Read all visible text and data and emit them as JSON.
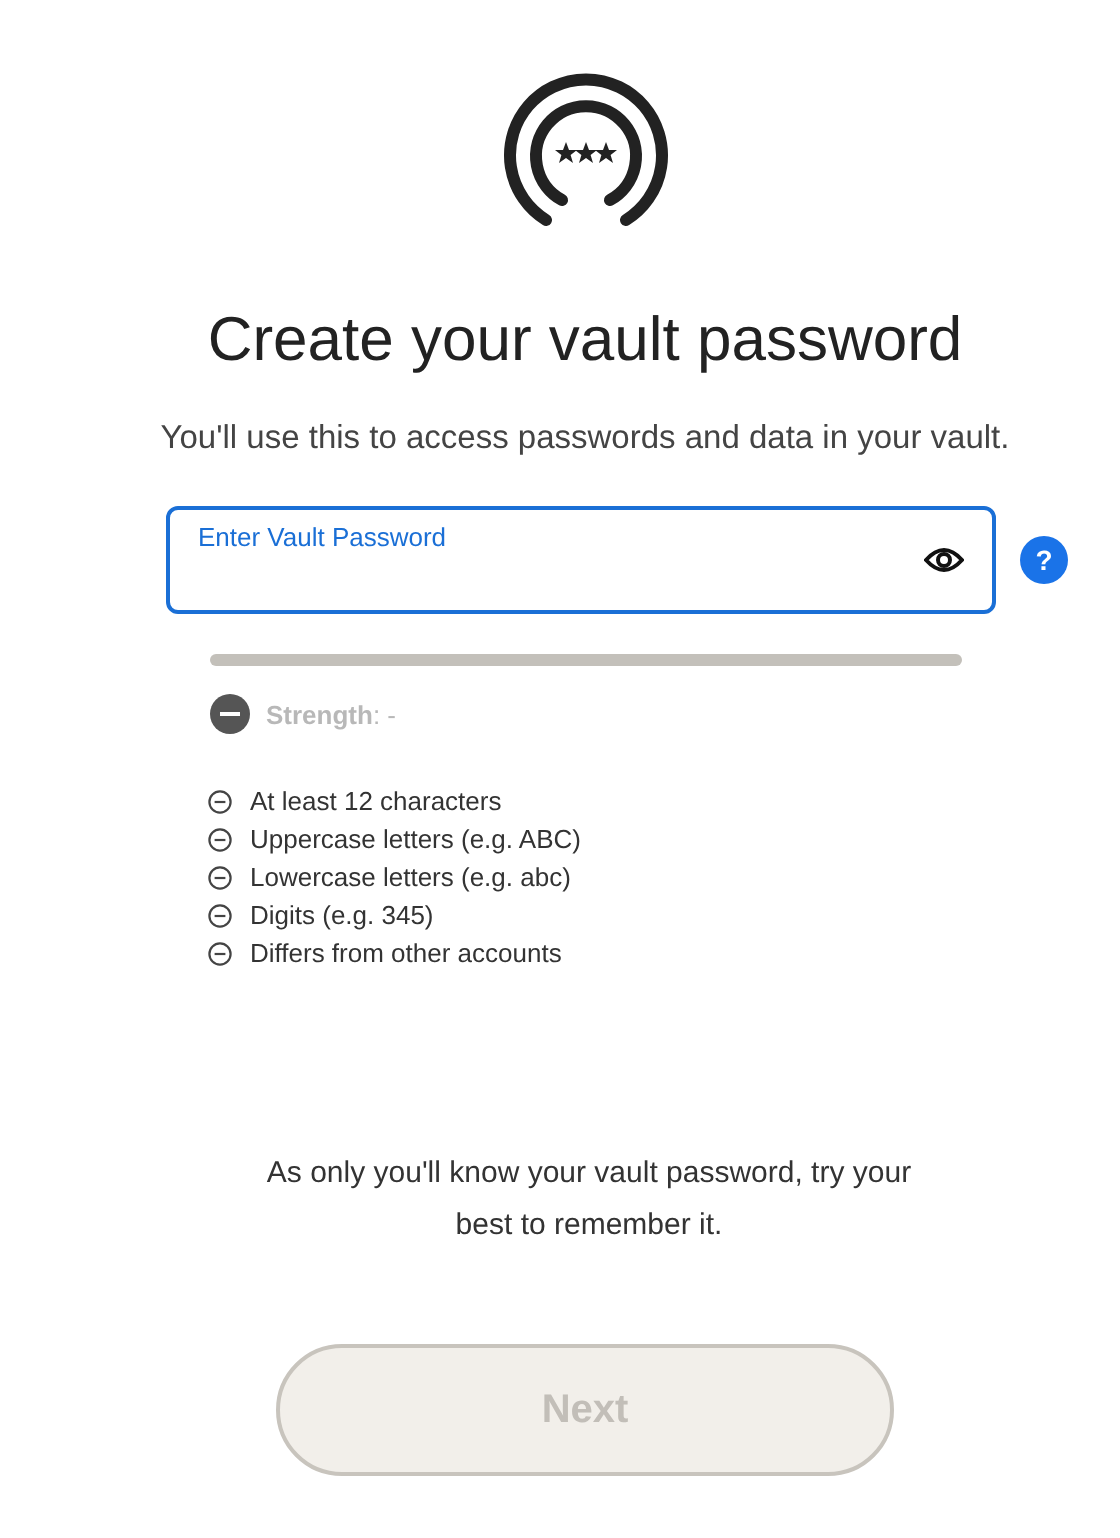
{
  "title": "Create your vault password",
  "subtitle": "You'll use this to access passwords and data in your vault.",
  "password_field": {
    "placeholder": "Enter Vault Password",
    "focused": true
  },
  "help_button": {
    "label": "?"
  },
  "strength": {
    "level": 0,
    "label": "**Strength**: -"
  },
  "requirements": [
    {
      "text": "At least 12 characters",
      "met": false
    },
    {
      "text": "Uppercase letters (e.g. ABC)",
      "met": false
    },
    {
      "text": "Lowercase letters (e.g. abc)",
      "met": false
    },
    {
      "text": "Digits (e.g. 345)",
      "met": false
    },
    {
      "text": "Differs from other accounts",
      "met": false
    }
  ],
  "note": "As only you'll know your vault password, try your best to remember it.",
  "next_button": {
    "label": "Next",
    "disabled": true
  }
}
